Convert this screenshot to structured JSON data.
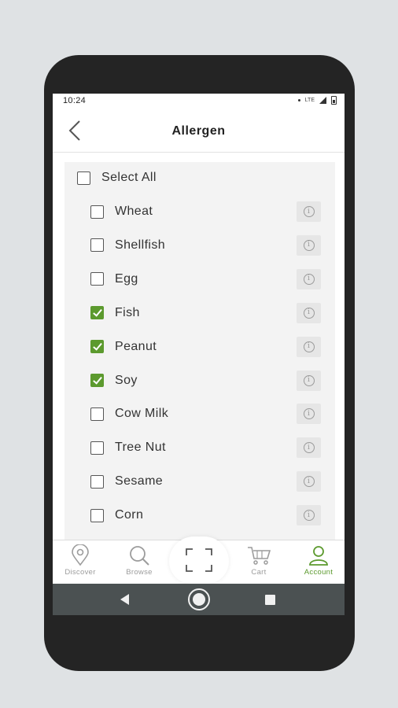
{
  "status_bar": {
    "time": "10:24",
    "network": "LTE"
  },
  "header": {
    "title": "Allergen",
    "back_icon": "chevron-left-icon"
  },
  "select_all": {
    "label": "Select All",
    "checked": false
  },
  "allergens": [
    {
      "label": "Wheat",
      "checked": false
    },
    {
      "label": "Shellfish",
      "checked": false
    },
    {
      "label": "Egg",
      "checked": false
    },
    {
      "label": "Fish",
      "checked": true
    },
    {
      "label": "Peanut",
      "checked": true
    },
    {
      "label": "Soy",
      "checked": true
    },
    {
      "label": "Cow Milk",
      "checked": false
    },
    {
      "label": "Tree Nut",
      "checked": false
    },
    {
      "label": "Sesame",
      "checked": false
    },
    {
      "label": "Corn",
      "checked": false
    }
  ],
  "info_icon": "info-icon",
  "bottom_nav": {
    "items": [
      {
        "label": "Discover",
        "icon": "map-pin-icon",
        "active": false
      },
      {
        "label": "Browse",
        "icon": "search-icon",
        "active": false
      },
      {
        "label": "Cart",
        "icon": "cart-icon",
        "active": false
      },
      {
        "label": "Account",
        "icon": "user-icon",
        "active": true
      }
    ],
    "scan_icon": "scan-icon"
  },
  "colors": {
    "accent": "#5c9a2e",
    "inactive": "#9c9c9c",
    "panel": "#f3f3f3",
    "system_bar": "#4b5152"
  }
}
